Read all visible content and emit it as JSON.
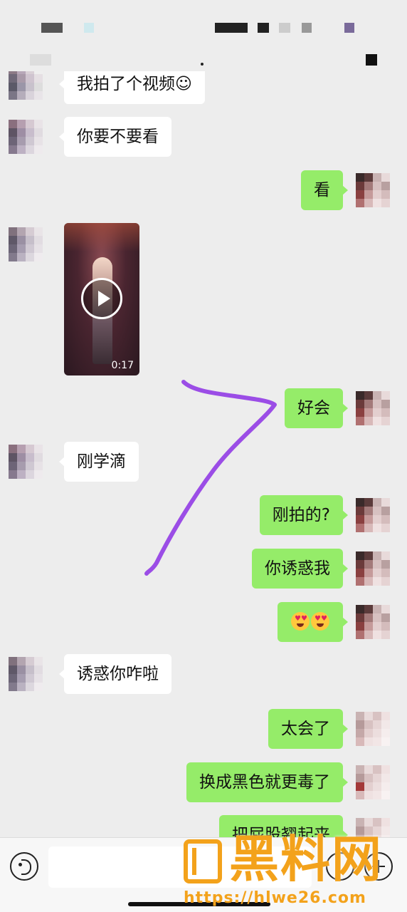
{
  "messages": [
    {
      "side": "in",
      "text": "我拍了个视频☺"
    },
    {
      "side": "in",
      "text": "你要不要看"
    },
    {
      "side": "out",
      "text": "看"
    },
    {
      "side": "in",
      "type": "video",
      "duration": "0:17"
    },
    {
      "side": "out",
      "text": "好会"
    },
    {
      "side": "in",
      "text": "刚学滴"
    },
    {
      "side": "out",
      "text": "刚拍的?"
    },
    {
      "side": "out",
      "text": "你诱惑我"
    },
    {
      "side": "out",
      "type": "emoji",
      "emoji": "heart-eyes-face x2"
    },
    {
      "side": "in",
      "text": "诱惑你咋啦"
    },
    {
      "side": "out",
      "text": "太会了"
    },
    {
      "side": "out",
      "text": "换成黑色就更毒了"
    },
    {
      "side": "out",
      "text": "把屁股翘起来"
    }
  ],
  "annotation": {
    "color": "#9b4de6"
  },
  "watermark": {
    "title": "黑料网",
    "url": "https://hlwe26.com"
  },
  "colors": {
    "background": "#ededed",
    "outgoing_bubble": "#95ec69",
    "incoming_bubble": "#ffffff",
    "watermark": "#f3a21b"
  }
}
